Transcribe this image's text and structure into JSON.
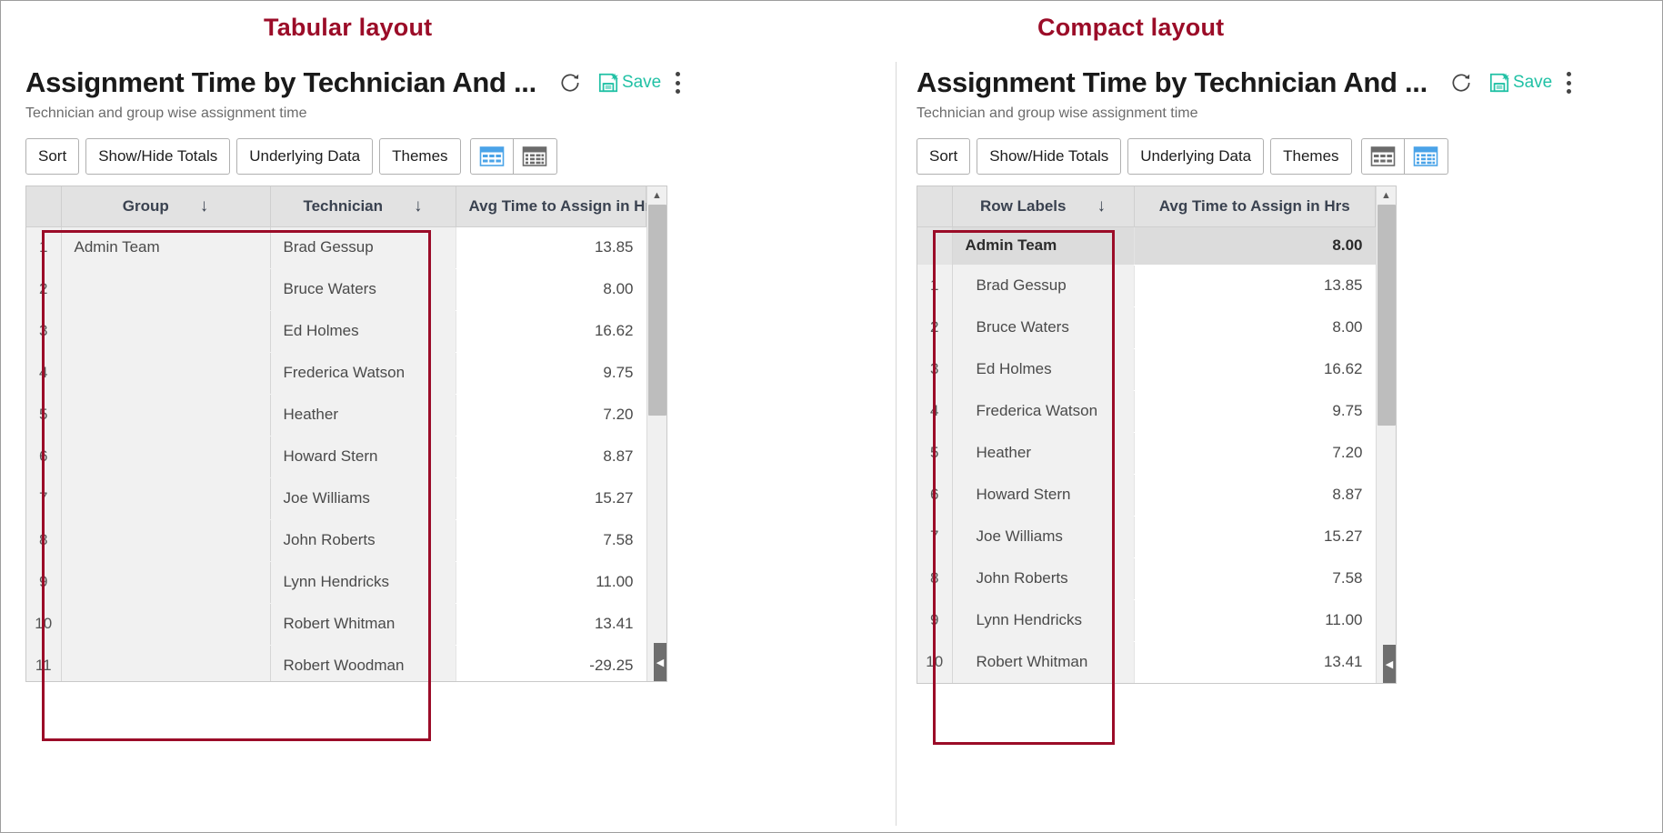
{
  "annotations": {
    "left_caption": "Tabular layout",
    "right_caption": "Compact layout",
    "accent_color": "#9b0c28"
  },
  "report": {
    "title": "Assignment Time by Technician And ...",
    "subtitle": "Technician and group wise assignment time",
    "save_label": "Save",
    "icons": {
      "refresh": "refresh-icon",
      "save": "save-floppy-icon",
      "more": "kebab-menu-icon"
    },
    "toolbar": {
      "sort": "Sort",
      "show_hide_totals": "Show/Hide Totals",
      "underlying_data": "Underlying Data",
      "themes": "Themes",
      "view_tabular": "tabular-layout-icon",
      "view_compact": "compact-layout-icon"
    }
  },
  "tabular": {
    "active_view": "tabular",
    "headers": {
      "group": "Group",
      "technician": "Technician",
      "value": "Avg Time to Assign in Hrs",
      "sort_arrow": "↓"
    },
    "rows": [
      {
        "n": "1",
        "group": "Admin Team",
        "technician": "Brad Gessup",
        "value": "13.85"
      },
      {
        "n": "2",
        "group": "",
        "technician": "Bruce Waters",
        "value": "8.00"
      },
      {
        "n": "3",
        "group": "",
        "technician": "Ed Holmes",
        "value": "16.62"
      },
      {
        "n": "4",
        "group": "",
        "technician": "Frederica Watson",
        "value": "9.75"
      },
      {
        "n": "5",
        "group": "",
        "technician": "Heather",
        "value": "7.20"
      },
      {
        "n": "6",
        "group": "",
        "technician": "Howard Stern",
        "value": "8.87"
      },
      {
        "n": "7",
        "group": "",
        "technician": "Joe Williams",
        "value": "15.27"
      },
      {
        "n": "8",
        "group": "",
        "technician": "John Roberts",
        "value": "7.58"
      },
      {
        "n": "9",
        "group": "",
        "technician": "Lynn Hendricks",
        "value": "11.00"
      },
      {
        "n": "10",
        "group": "",
        "technician": "Robert Whitman",
        "value": "13.41"
      },
      {
        "n": "11",
        "group": "",
        "technician": "Robert Woodman",
        "value": "-29.25"
      }
    ],
    "scroll": {
      "thumb_top_pct": 0,
      "thumb_height_pct": 46
    }
  },
  "compact": {
    "active_view": "compact",
    "headers": {
      "row_labels": "Row Labels",
      "value": "Avg Time to Assign in Hrs",
      "sort_arrow": "↓"
    },
    "group_row": {
      "label": "Admin Team",
      "value": "8.00"
    },
    "rows": [
      {
        "n": "1",
        "label": "Brad Gessup",
        "value": "13.85"
      },
      {
        "n": "2",
        "label": "Bruce Waters",
        "value": "8.00"
      },
      {
        "n": "3",
        "label": "Ed Holmes",
        "value": "16.62"
      },
      {
        "n": "4",
        "label": "Frederica Watson",
        "value": "9.75"
      },
      {
        "n": "5",
        "label": "Heather",
        "value": "7.20"
      },
      {
        "n": "6",
        "label": "Howard Stern",
        "value": "8.87"
      },
      {
        "n": "7",
        "label": "Joe Williams",
        "value": "15.27"
      },
      {
        "n": "8",
        "label": "John Roberts",
        "value": "7.58"
      },
      {
        "n": "9",
        "label": "Lynn Hendricks",
        "value": "11.00"
      },
      {
        "n": "10",
        "label": "Robert Whitman",
        "value": "13.41"
      }
    ],
    "scroll": {
      "thumb_top_pct": 0,
      "thumb_height_pct": 48
    }
  }
}
